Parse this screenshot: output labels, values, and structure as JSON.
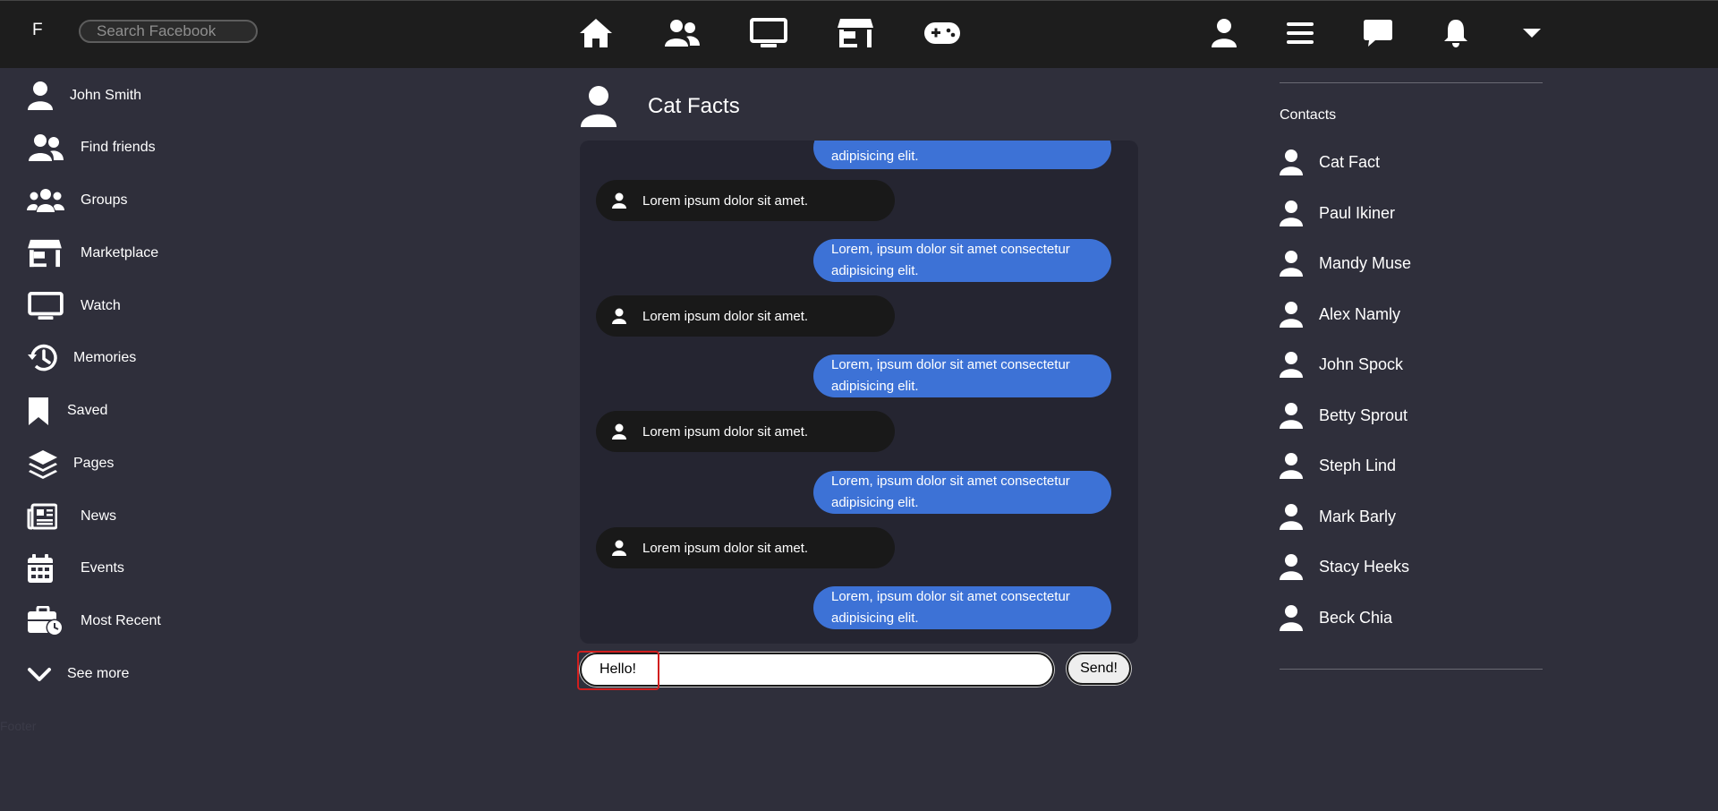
{
  "topbar": {
    "brand": "F",
    "search_placeholder": "Search Facebook",
    "nav_icons": [
      "home-icon",
      "friends-icon",
      "watch-icon",
      "marketplace-icon",
      "gaming-icon"
    ],
    "right_icons": [
      "profile-icon",
      "menu-icon",
      "messenger-icon",
      "notifications-icon",
      "caret-down-icon"
    ]
  },
  "sidebar": {
    "items": [
      {
        "label": "John Smith",
        "icon": "user-icon"
      },
      {
        "label": "Find friends",
        "icon": "friends-icon"
      },
      {
        "label": "Groups",
        "icon": "groups-icon"
      },
      {
        "label": "Marketplace",
        "icon": "marketplace-icon"
      },
      {
        "label": "Watch",
        "icon": "watch-icon"
      },
      {
        "label": "Memories",
        "icon": "history-icon"
      },
      {
        "label": "Saved",
        "icon": "bookmark-icon"
      },
      {
        "label": "Pages",
        "icon": "layers-icon"
      },
      {
        "label": "News",
        "icon": "newspaper-icon"
      },
      {
        "label": "Events",
        "icon": "calendar-icon"
      },
      {
        "label": "Most Recent",
        "icon": "briefcase-clock-icon"
      },
      {
        "label": "See more",
        "icon": "chevron-down-icon"
      }
    ]
  },
  "footer": "Footer",
  "chat": {
    "title": "Cat Facts",
    "partial_message": "adipisicing elit.",
    "messages": [
      {
        "from": "them",
        "text": "Lorem ipsum dolor sit amet."
      },
      {
        "from": "me",
        "line1": "Lorem, ipsum dolor sit amet consectetur",
        "line2": "adipisicing elit."
      },
      {
        "from": "them",
        "text": "Lorem ipsum dolor sit amet."
      },
      {
        "from": "me",
        "line1": "Lorem, ipsum dolor sit amet consectetur",
        "line2": "adipisicing elit."
      },
      {
        "from": "them",
        "text": "Lorem ipsum dolor sit amet."
      },
      {
        "from": "me",
        "line1": "Lorem, ipsum dolor sit amet consectetur",
        "line2": "adipisicing elit."
      },
      {
        "from": "them",
        "text": "Lorem ipsum dolor sit amet."
      },
      {
        "from": "me",
        "line1": "Lorem, ipsum dolor sit amet consectetur",
        "line2": "adipisicing elit."
      }
    ],
    "input_value": "Hello!",
    "send_label": "Send!"
  },
  "contacts": {
    "heading": "Contacts",
    "items": [
      "Cat Fact",
      "Paul Ikiner",
      "Mandy Muse",
      "Alex Namly",
      "John Spock",
      "Betty Sprout",
      "Steph Lind",
      "Mark Barly",
      "Stacy Heeks",
      "Beck Chia"
    ]
  },
  "colors": {
    "background": "#2f2f3b",
    "topbar": "#1d1d1d",
    "chat_panel": "#252531",
    "incoming_bubble": "#191919",
    "outgoing_bubble": "#3d72d6",
    "annotation": "#d11e1e"
  }
}
